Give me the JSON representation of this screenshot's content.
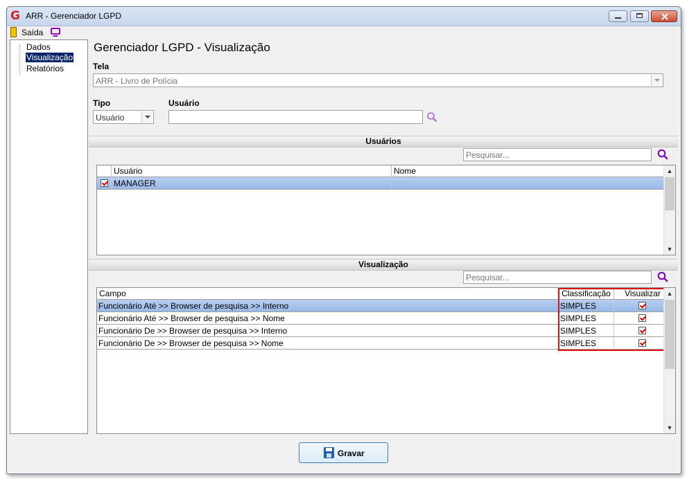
{
  "window": {
    "title": "ARR - Gerenciador LGPD",
    "logo_letter": "G"
  },
  "toolbar": {
    "exit_label": "Saída"
  },
  "sidebar": {
    "items": [
      {
        "label": "Dados",
        "selected": false
      },
      {
        "label": "Visualização",
        "selected": true
      },
      {
        "label": "Relatórios",
        "selected": false
      }
    ]
  },
  "main": {
    "title": "Gerenciador LGPD - Visualização",
    "tela": {
      "label": "Tela",
      "value": "ARR - Livro de Polícia"
    },
    "tipo": {
      "label": "Tipo",
      "value": "Usuário"
    },
    "usuario": {
      "label": "Usuário",
      "value": ""
    }
  },
  "users_section": {
    "title": "Usuários",
    "search_placeholder": "Pesquisar...",
    "columns": [
      "Usuário",
      "Nome"
    ],
    "rows": [
      {
        "checked": true,
        "usuario": "MANAGER",
        "nome": ""
      }
    ]
  },
  "vis_section": {
    "title": "Visualização",
    "search_placeholder": "Pesquisar...",
    "columns": [
      "Campo",
      "Classificação",
      "Visualizar"
    ],
    "rows": [
      {
        "campo": "Funcionário Até >> Browser de pesquisa >> Interno",
        "classificacao": "SIMPLES",
        "visualizar": true
      },
      {
        "campo": "Funcionário Até >> Browser de pesquisa >> Nome",
        "classificacao": "SIMPLES",
        "visualizar": true
      },
      {
        "campo": "Funcionário De >> Browser de pesquisa >> Interno",
        "classificacao": "SIMPLES",
        "visualizar": true
      },
      {
        "campo": "Funcionário De >> Browser de pesquisa >> Nome",
        "classificacao": "SIMPLES",
        "visualizar": true
      }
    ]
  },
  "footer": {
    "save_label": "Gravar"
  },
  "colors": {
    "highlight_border": "#e01010",
    "selection": "#97b8e8",
    "accent_icon": "#a600c8"
  }
}
